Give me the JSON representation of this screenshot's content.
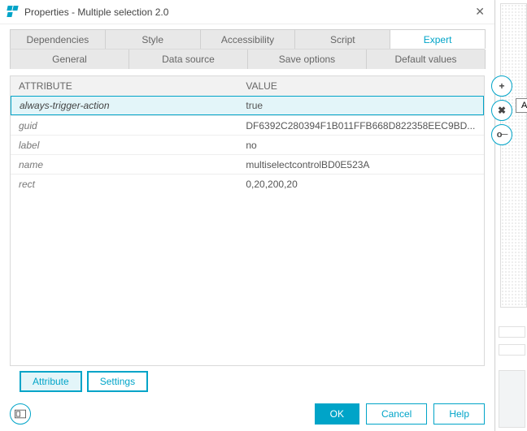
{
  "window": {
    "title": "Properties - Multiple selection 2.0"
  },
  "tabs_top": [
    "Dependencies",
    "Style",
    "Accessibility",
    "Script",
    "Expert"
  ],
  "tabs_top_active": 4,
  "tabs_bottom": [
    "General",
    "Data source",
    "Save options",
    "Default values"
  ],
  "grid": {
    "col_attr": "ATTRIBUTE",
    "col_value": "VALUE",
    "rows": [
      {
        "attr": "always-trigger-action",
        "value": "true",
        "selected": true
      },
      {
        "attr": "guid",
        "value": "DF6392C280394F1B011FFB668D822358EEC9BD..."
      },
      {
        "attr": "label",
        "value": "no"
      },
      {
        "attr": "name",
        "value": "multiselectcontrolBD0E523A"
      },
      {
        "attr": "rect",
        "value": "0,20,200,20"
      }
    ]
  },
  "side_actions": {
    "add": {
      "glyph": "+",
      "tooltip": "Add attribute"
    },
    "delete": {
      "glyph": "✖"
    },
    "key": {
      "glyph": "⚿"
    }
  },
  "bottom_segmented": {
    "attribute": "Attribute",
    "settings": "Settings"
  },
  "footer": {
    "ok": "OK",
    "cancel": "Cancel",
    "help": "Help"
  }
}
